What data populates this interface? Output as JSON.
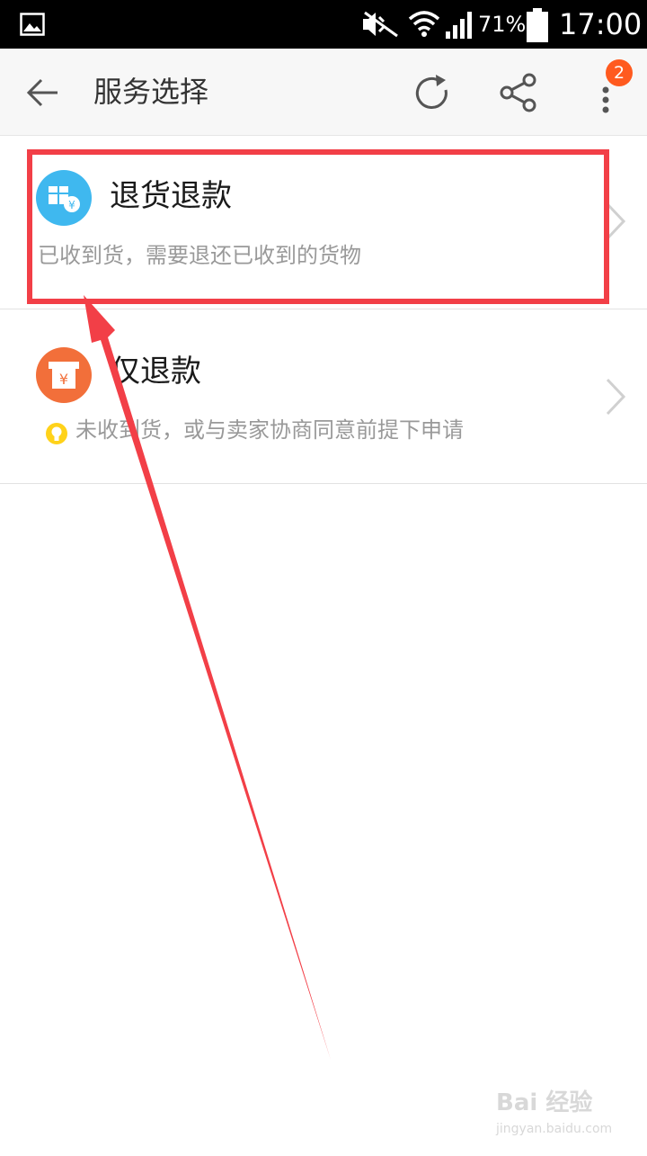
{
  "status_bar": {
    "battery_percent": "71%",
    "time": "17:00",
    "icons": [
      "gallery-icon",
      "mute-icon",
      "wifi-icon",
      "signal-icon",
      "battery-icon"
    ]
  },
  "app_bar": {
    "title": "服务选择",
    "notification_count": "2",
    "icons": [
      "back-arrow-icon",
      "refresh-icon",
      "share-icon",
      "more-vert-icon"
    ]
  },
  "options": [
    {
      "title": "退货退款",
      "description": "已收到货，需要退还已收到的货物",
      "icon": "return-goods-icon",
      "icon_color": "#3fb8ef"
    },
    {
      "title": "仅退款",
      "description": "未收到货，或与卖家协商同意前提下申请",
      "icon": "refund-only-icon",
      "icon_color": "#f26f3a",
      "tip_icon": "lightbulb-icon"
    }
  ],
  "annotation": {
    "highlight_color": "#f23f47",
    "arrow_color": "#f23f47"
  },
  "watermark": {
    "main": "Bai 经验",
    "sub": "jingyan.baidu.com"
  }
}
